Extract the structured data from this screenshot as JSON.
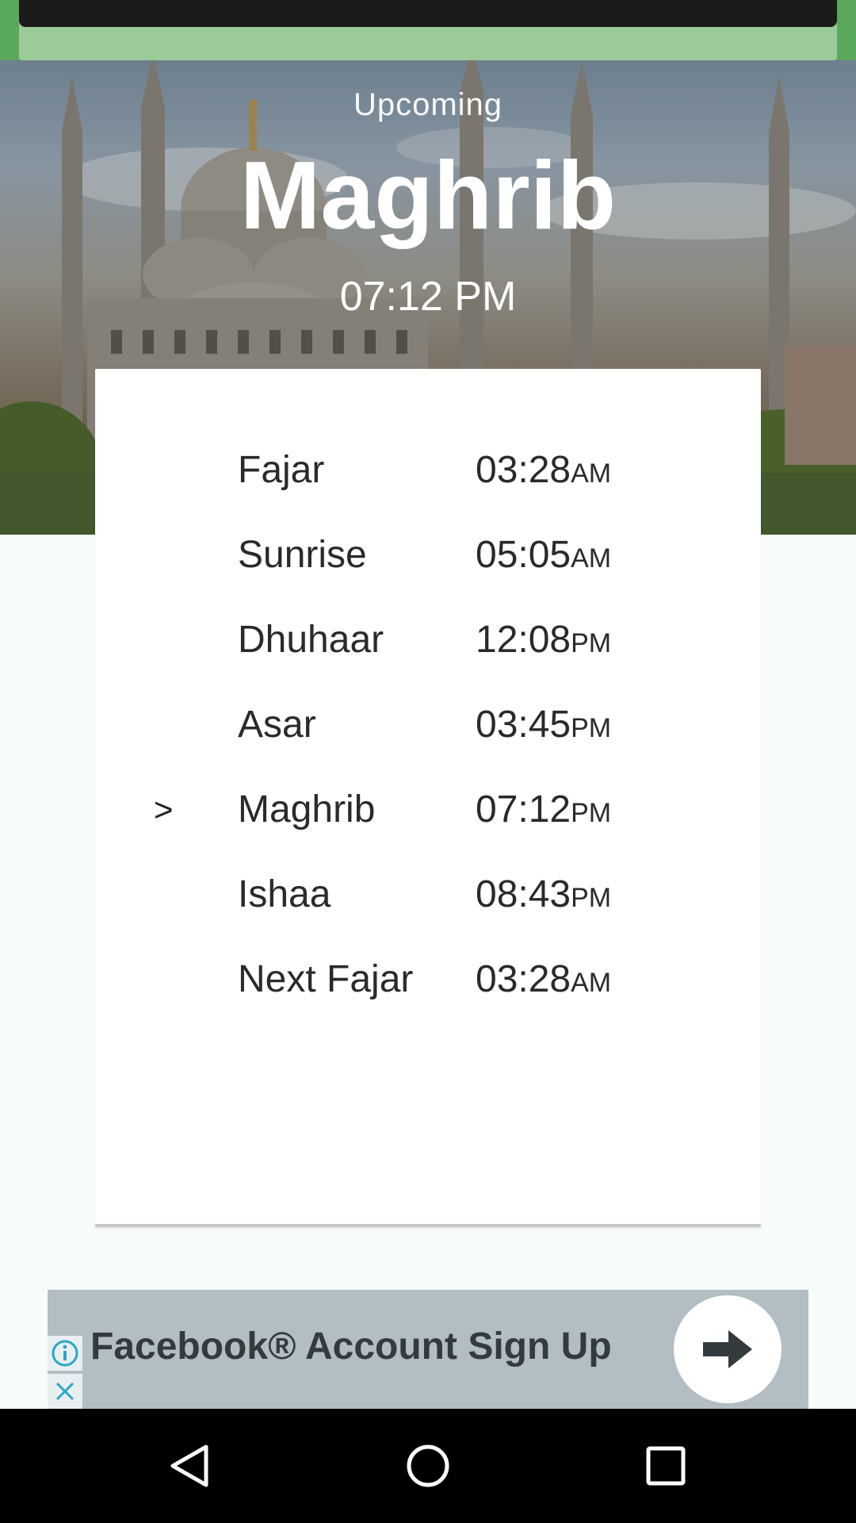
{
  "header": {
    "upcoming_label": "Upcoming",
    "prayer_name": "Maghrib",
    "prayer_time": "07:12 PM"
  },
  "prayers": [
    {
      "name": "Fajar",
      "time": "03:28",
      "ampm": "AM",
      "marker": ""
    },
    {
      "name": "Sunrise",
      "time": "05:05",
      "ampm": "AM",
      "marker": ""
    },
    {
      "name": "Dhuhaar",
      "time": "12:08",
      "ampm": "PM",
      "marker": ""
    },
    {
      "name": "Asar",
      "time": "03:45",
      "ampm": "PM",
      "marker": ""
    },
    {
      "name": "Maghrib",
      "time": "07:12",
      "ampm": "PM",
      "marker": ">"
    },
    {
      "name": "Ishaa",
      "time": "08:43",
      "ampm": "PM",
      "marker": ""
    },
    {
      "name": "Next Fajar",
      "time": "03:28",
      "ampm": "AM",
      "marker": ""
    }
  ],
  "ad": {
    "text": "Facebook® Account Sign Up",
    "info_icon": "info-icon",
    "close_icon": "close-icon",
    "arrow_icon": "arrow-right-icon"
  },
  "navbar": {
    "back_icon": "back-triangle-icon",
    "home_icon": "home-circle-icon",
    "recents_icon": "recents-square-icon"
  },
  "colors": {
    "status_green": "#5aa85a",
    "ad_background": "#b2bec3",
    "ad_accent": "#2aa7c4"
  }
}
